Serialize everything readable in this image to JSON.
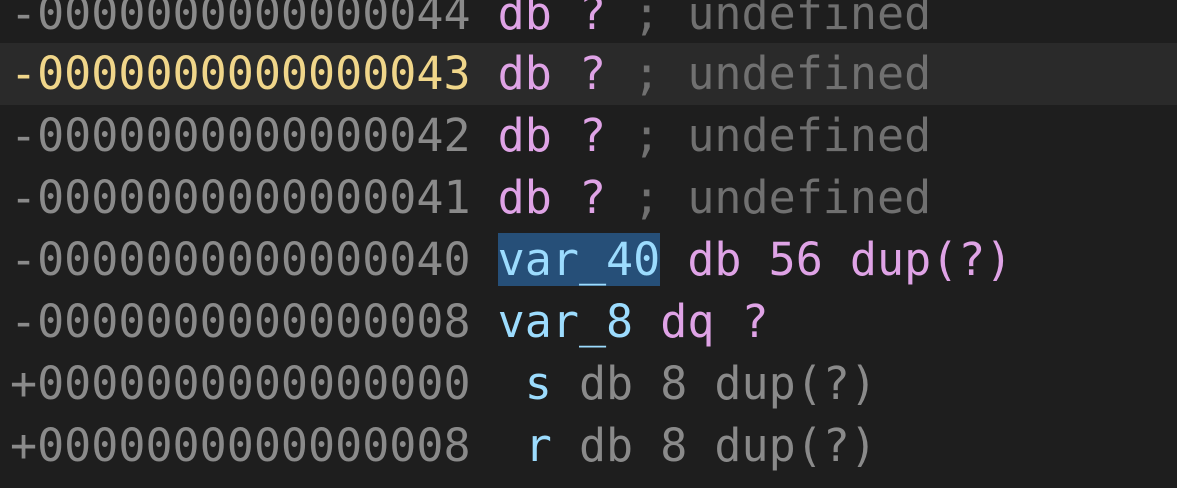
{
  "lines": [
    {
      "offset": "-0000000000000044",
      "tokens": [
        "db",
        "?",
        "; undefined"
      ]
    },
    {
      "offset": "-0000000000000043",
      "tokens": [
        "db",
        "?",
        "; undefined"
      ]
    },
    {
      "offset": "-0000000000000042",
      "tokens": [
        "db",
        "?",
        "; undefined"
      ]
    },
    {
      "offset": "-0000000000000041",
      "tokens": [
        "db",
        "?",
        "; undefined"
      ]
    },
    {
      "offset": "-0000000000000040",
      "tokens": [
        "var_40",
        "db",
        "56",
        "dup(?)"
      ]
    },
    {
      "offset": "-0000000000000008",
      "tokens": [
        "var_8",
        "dq",
        "?"
      ]
    },
    {
      "offset": "+0000000000000000",
      "tokens": [
        "s",
        "db",
        "8",
        "dup(?)"
      ]
    },
    {
      "offset": "+0000000000000008",
      "tokens": [
        "r",
        "db",
        "8",
        "dup(?)"
      ]
    }
  ],
  "colors": {
    "background": "#1e1e1e",
    "current_line": "#2a2a2a",
    "current_offset": "#f0d68a",
    "offset": "#8a8a8a",
    "keyword": "#dfa3e6",
    "comment": "#707070",
    "name": "#9cdcfe",
    "selection": "#264f78"
  }
}
